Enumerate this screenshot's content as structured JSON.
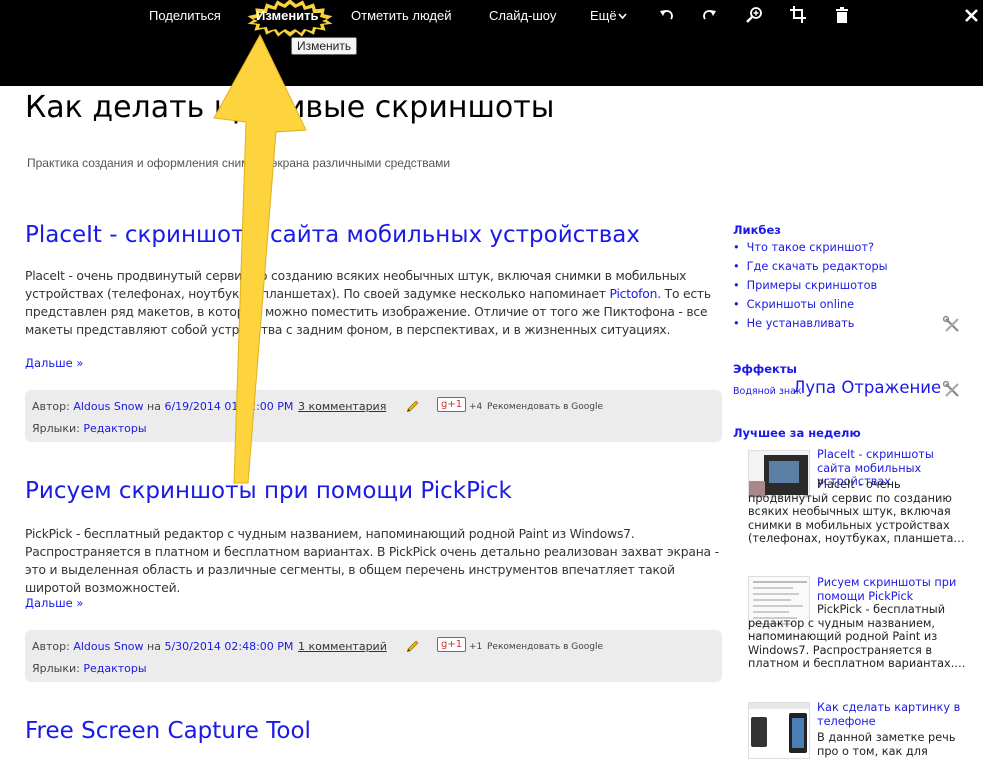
{
  "toolbar": {
    "share": "Поделиться",
    "edit": "Изменить",
    "tag_people": "Отметить людей",
    "slideshow": "Слайд-шоу",
    "more": "Ещё",
    "tooltip": "Изменить",
    "icons": [
      "rotate-left-icon",
      "rotate-right-icon",
      "zoom-icon",
      "crop-icon",
      "trash-icon",
      "close-icon"
    ]
  },
  "blog": {
    "title": "Как делать красивые скриншоты",
    "description": "Практика создания и оформления снимков экрана различными средствами"
  },
  "posts": [
    {
      "title": "PlaceIt - скриншоты сайта мобильных устройствах",
      "body_before_link": "PlaceIt - очень продвинутый сервис по созданию всяких необычных штук, включая снимки в мобильных устройствах (телефонах, ноутбуках, планшетах). По своей задумке несколько напоминает ",
      "link": "Pictofon",
      "body_after_link": ". То есть представлен ряд макетов, в которые можно поместить изображение. Отличие от того же Пиктофона - все макеты представляют собой устройства с задним фоном, в перспективах, и в жизненных ситуациях.",
      "more": "Дальше »",
      "author_label": "Автор:",
      "author": "Aldous Snow",
      "on": "на",
      "date": "6/19/2014 01:32:00 PM",
      "comments": "3 комментария",
      "gplus": "g+1",
      "gcount": "+4",
      "grec": "Рекомендовать в Google",
      "labels_label": "Ярлыки:",
      "labels": "Редакторы"
    },
    {
      "title": "Рисуем скриншоты при помощи PickPick",
      "body": "PickPick - бесплатный редактор с чудным названием, напоминающий родной Paint из Windows7. Распространяется в платном и бесплатном вариантах. В PickPick очень детально реализован захват экрана - это и выделенная область и различные сегменты, в общем перечень инструментов впечатляет такой широтой возможностей.",
      "more": "Дальше »",
      "author_label": "Автор:",
      "author": "Aldous Snow",
      "on": "на",
      "date": "5/30/2014 02:48:00 PM",
      "comments": "1 комментарий",
      "gplus": "g+1",
      "gcount": "+1",
      "grec": "Рекомендовать в Google",
      "labels_label": "Ярлыки:",
      "labels": "Редакторы"
    },
    {
      "title": "Free Screen Capture Tool"
    }
  ],
  "sidebar": {
    "likbez": {
      "title": "Ликбез",
      "items": [
        "Что такое скриншот?",
        "Где скачать редакторы",
        "Примеры скриншотов",
        "Скриншоты online",
        "Не устанавливать"
      ]
    },
    "effects": {
      "title": "Эффекты",
      "small": "Водяной знак",
      "big": "Лупа Отражение"
    },
    "best": {
      "title": "Лучшее за неделю",
      "items": [
        {
          "title": "PlaceIt - скриншоты сайта мобильных устройствах",
          "snippet": "PlaceIt - очень продвинутый сервис по созданию всяких необычных штук, включая снимки в мобильных устройствах (телефонах, ноутбуках, планшета…"
        },
        {
          "title": "Рисуем скриншоты при помощи PickPick",
          "snippet": "PickPick - бесплатный редактор с чудным названием, напоминающий родной Paint из Windows7. Распространяется в платном и бесплатном вариантах.…"
        },
        {
          "title": "Как сделать картинку в телефоне",
          "snippet": "В данной заметке речь про о том, как для"
        }
      ]
    }
  },
  "colors": {
    "link": "#1a1ae6",
    "toolbar_bg": "#000000",
    "highlight": "#f7d23a",
    "footer_bg": "#ececec"
  }
}
